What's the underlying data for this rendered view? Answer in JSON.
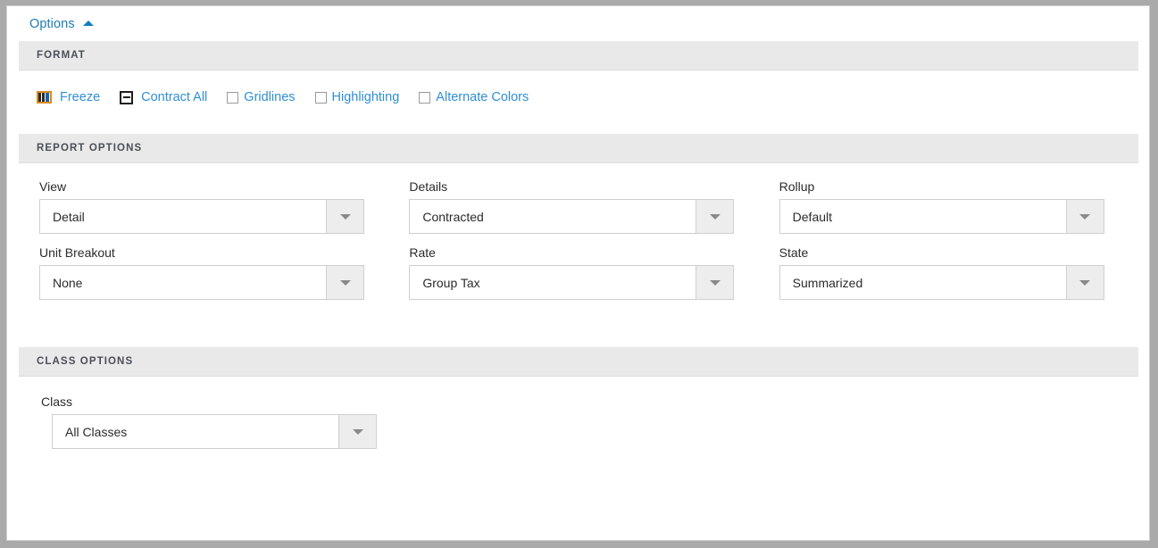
{
  "panel": {
    "options_toggle": {
      "label": "Options",
      "icon": "chevron-up-icon",
      "expanded": true
    },
    "sections": [
      {
        "id": "format",
        "title": "FORMAT",
        "tools": [
          {
            "id": "freeze",
            "label": "Freeze",
            "icon": "freeze-columns-icon",
            "type": "link"
          },
          {
            "id": "contract-all",
            "label": "Contract All",
            "icon": "contract-all-icon",
            "type": "link"
          },
          {
            "id": "gridlines",
            "label": "Gridlines",
            "icon": "checkbox-icon",
            "type": "checkbox",
            "checked": false
          },
          {
            "id": "highlighting",
            "label": "Highlighting",
            "icon": "checkbox-icon",
            "type": "checkbox",
            "checked": false
          },
          {
            "id": "alternate-colors",
            "label": "Alternate Colors",
            "icon": "checkbox-icon",
            "type": "checkbox",
            "checked": false
          }
        ]
      },
      {
        "id": "report-options",
        "title": "REPORT OPTIONS",
        "fields": [
          {
            "id": "view",
            "label": "View",
            "value": "Detail"
          },
          {
            "id": "details",
            "label": "Details",
            "value": "Contracted"
          },
          {
            "id": "rollup",
            "label": "Rollup",
            "value": "Default"
          },
          {
            "id": "unit-breakout",
            "label": "Unit Breakout",
            "value": "None"
          },
          {
            "id": "rate",
            "label": "Rate",
            "value": "Group Tax"
          },
          {
            "id": "state",
            "label": "State",
            "value": "Summarized"
          }
        ]
      },
      {
        "id": "class-options",
        "title": "CLASS OPTIONS",
        "fields": [
          {
            "id": "class",
            "label": "Class",
            "value": "All Classes"
          }
        ]
      }
    ],
    "colors": {
      "link": "#2f8ed6",
      "options_link": "#1e7bb5",
      "section_band": "#e9e9e9",
      "section_title": "#4a4f57",
      "field_border": "#cfcfcf",
      "dropdown_button": "#ededed",
      "frame": "#aaaaaa"
    }
  }
}
